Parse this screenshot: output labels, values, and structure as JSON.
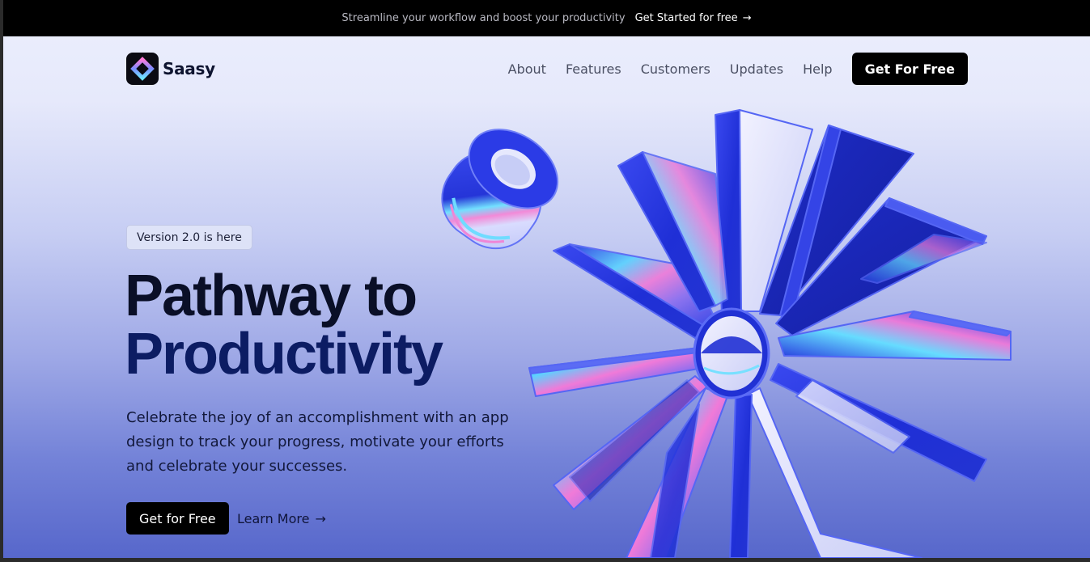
{
  "announcement": {
    "message": "Streamline your workflow and boost your productivity",
    "cta_label": "Get Started for free",
    "cta_icon": "arrow-right-icon"
  },
  "brand": {
    "name": "Saasy",
    "logo_icon": "diamond-logo-icon"
  },
  "nav": {
    "items": [
      "About",
      "Features",
      "Customers",
      "Updates",
      "Help"
    ],
    "cta_label": "Get For Free"
  },
  "hero": {
    "badge": "Version 2.0 is here",
    "headline_line1": "Pathway to",
    "headline_line2": "Productivity",
    "description": "Celebrate the joy of an accomplishment with an app design to track your progress, motivate your efforts and celebrate your successes.",
    "primary_button": "Get for Free",
    "secondary_button": "Learn More",
    "secondary_icon": "arrow-right-icon"
  },
  "colors": {
    "announcement_bg": "#000000",
    "accent_blue": "#2434e0",
    "button_bg": "#000000",
    "headline_dark": "#0a0f27",
    "headline_navy": "#0c1c63"
  }
}
